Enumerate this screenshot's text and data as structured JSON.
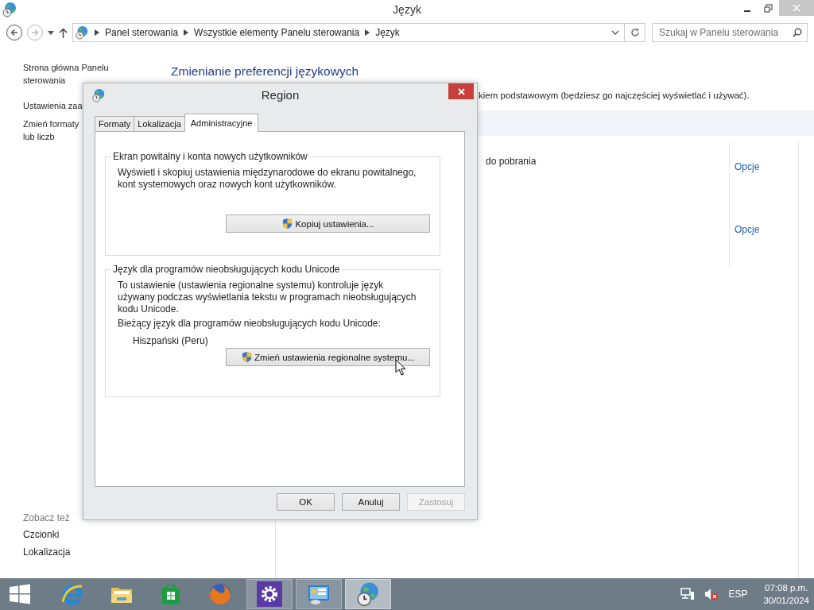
{
  "window": {
    "title": "Język",
    "address_path": [
      "Panel sterowania",
      "Wszystkie elementy Panelu sterowania",
      "Język"
    ],
    "search_placeholder": "Szukaj w Panelu sterowania"
  },
  "sidebar": {
    "links": [
      "Strona główna Panelu\nsterowania",
      "Ustawienia zaa",
      "Zmień formaty\nlub liczb"
    ],
    "see_also_label": "Zobacz też",
    "see_also": [
      "Czcionki",
      "Lokalizacja"
    ]
  },
  "content": {
    "heading": "Zmienianie preferencji językowych",
    "intro": "kiem podstawowym (będziesz go najczęściej wyświetlać i używać).",
    "rows": [
      {
        "text": "do pobrania",
        "link": "Opcje"
      },
      {
        "link": "Opcje"
      }
    ]
  },
  "dialog": {
    "title": "Region",
    "tabs": [
      {
        "label": "Formaty",
        "selected": false
      },
      {
        "label": "Lokalizacja",
        "selected": false
      },
      {
        "label": "Administracyjne",
        "selected": true
      }
    ],
    "groups": [
      {
        "title": "Ekran powitalny i konta nowych użytkowników",
        "description": "Wyświetl i skopiuj ustawienia międzynarodowe do ekranu powitalnego, kont systemowych oraz nowych kont użytkowników.",
        "button": "Kopiuj ustawienia..."
      },
      {
        "title": "Język dla programów nieobsługujących kodu Unicode",
        "description": "To ustawienie (ustawienia regionalne systemu) kontroluje język używany podczas wyświetlania tekstu w programach nieobsługujących kodu Unicode.",
        "current_label": "Bieżący język dla programów nieobsługujących kodu Unicode:",
        "current_value": "Hiszpański (Peru)",
        "button": "Zmień ustawienia regionalne systemu..."
      }
    ],
    "buttons": [
      {
        "label": "OK",
        "disabled": false
      },
      {
        "label": "Anuluj",
        "disabled": false
      },
      {
        "label": "Zastosuj",
        "disabled": true
      }
    ]
  },
  "taskbar": {
    "apps": [
      {
        "kind": "ie",
        "running": false,
        "focused": false
      },
      {
        "kind": "explorer",
        "running": false,
        "focused": false
      },
      {
        "kind": "store",
        "running": false,
        "focused": false
      },
      {
        "kind": "firefox",
        "running": false,
        "focused": false
      },
      {
        "kind": "settings",
        "running": true,
        "focused": false
      },
      {
        "kind": "control-panel",
        "running": true,
        "focused": false
      },
      {
        "kind": "region",
        "running": true,
        "focused": true
      }
    ],
    "language": "ESP",
    "time": "07:08 p.m.",
    "date": "30/01/2024"
  }
}
